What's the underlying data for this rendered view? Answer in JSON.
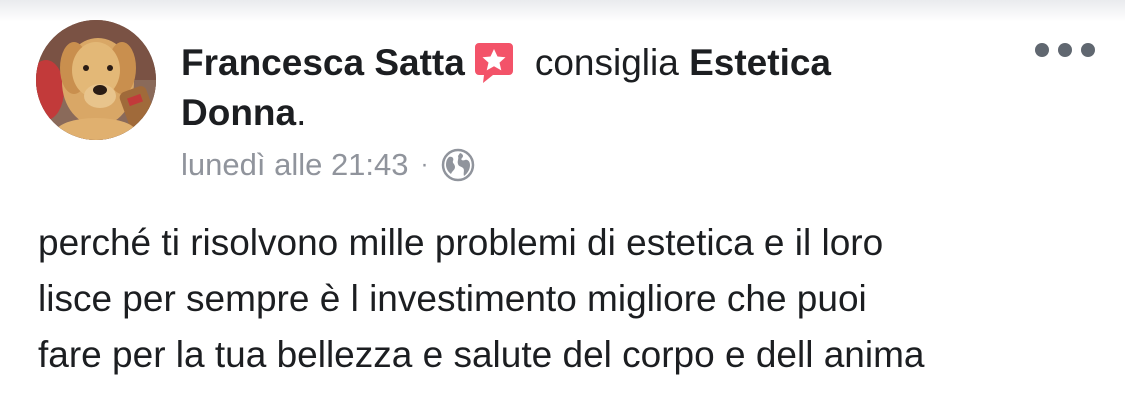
{
  "post": {
    "author": "Francesca Satta",
    "verb": "consiglia",
    "page_name_part1": "Estetica",
    "page_name_part2": "Donna",
    "period": ".",
    "timestamp": "lunedì alle 21:43",
    "separator": "·",
    "privacy_icon": "globe-icon",
    "recommendation_icon": "recommendation-star-icon",
    "more_icon": "more-options-icon",
    "body_lines": [
      "perché ti risolvono mille problemi di estetica e il loro",
      "lisce per sempre è l investimento migliore che puoi",
      "fare per la tua bellezza e salute del corpo e dell anima"
    ]
  },
  "colors": {
    "text_primary": "#1c1e21",
    "text_secondary": "#90949c",
    "badge_pink": "#f35369",
    "more_dots": "#606770"
  }
}
